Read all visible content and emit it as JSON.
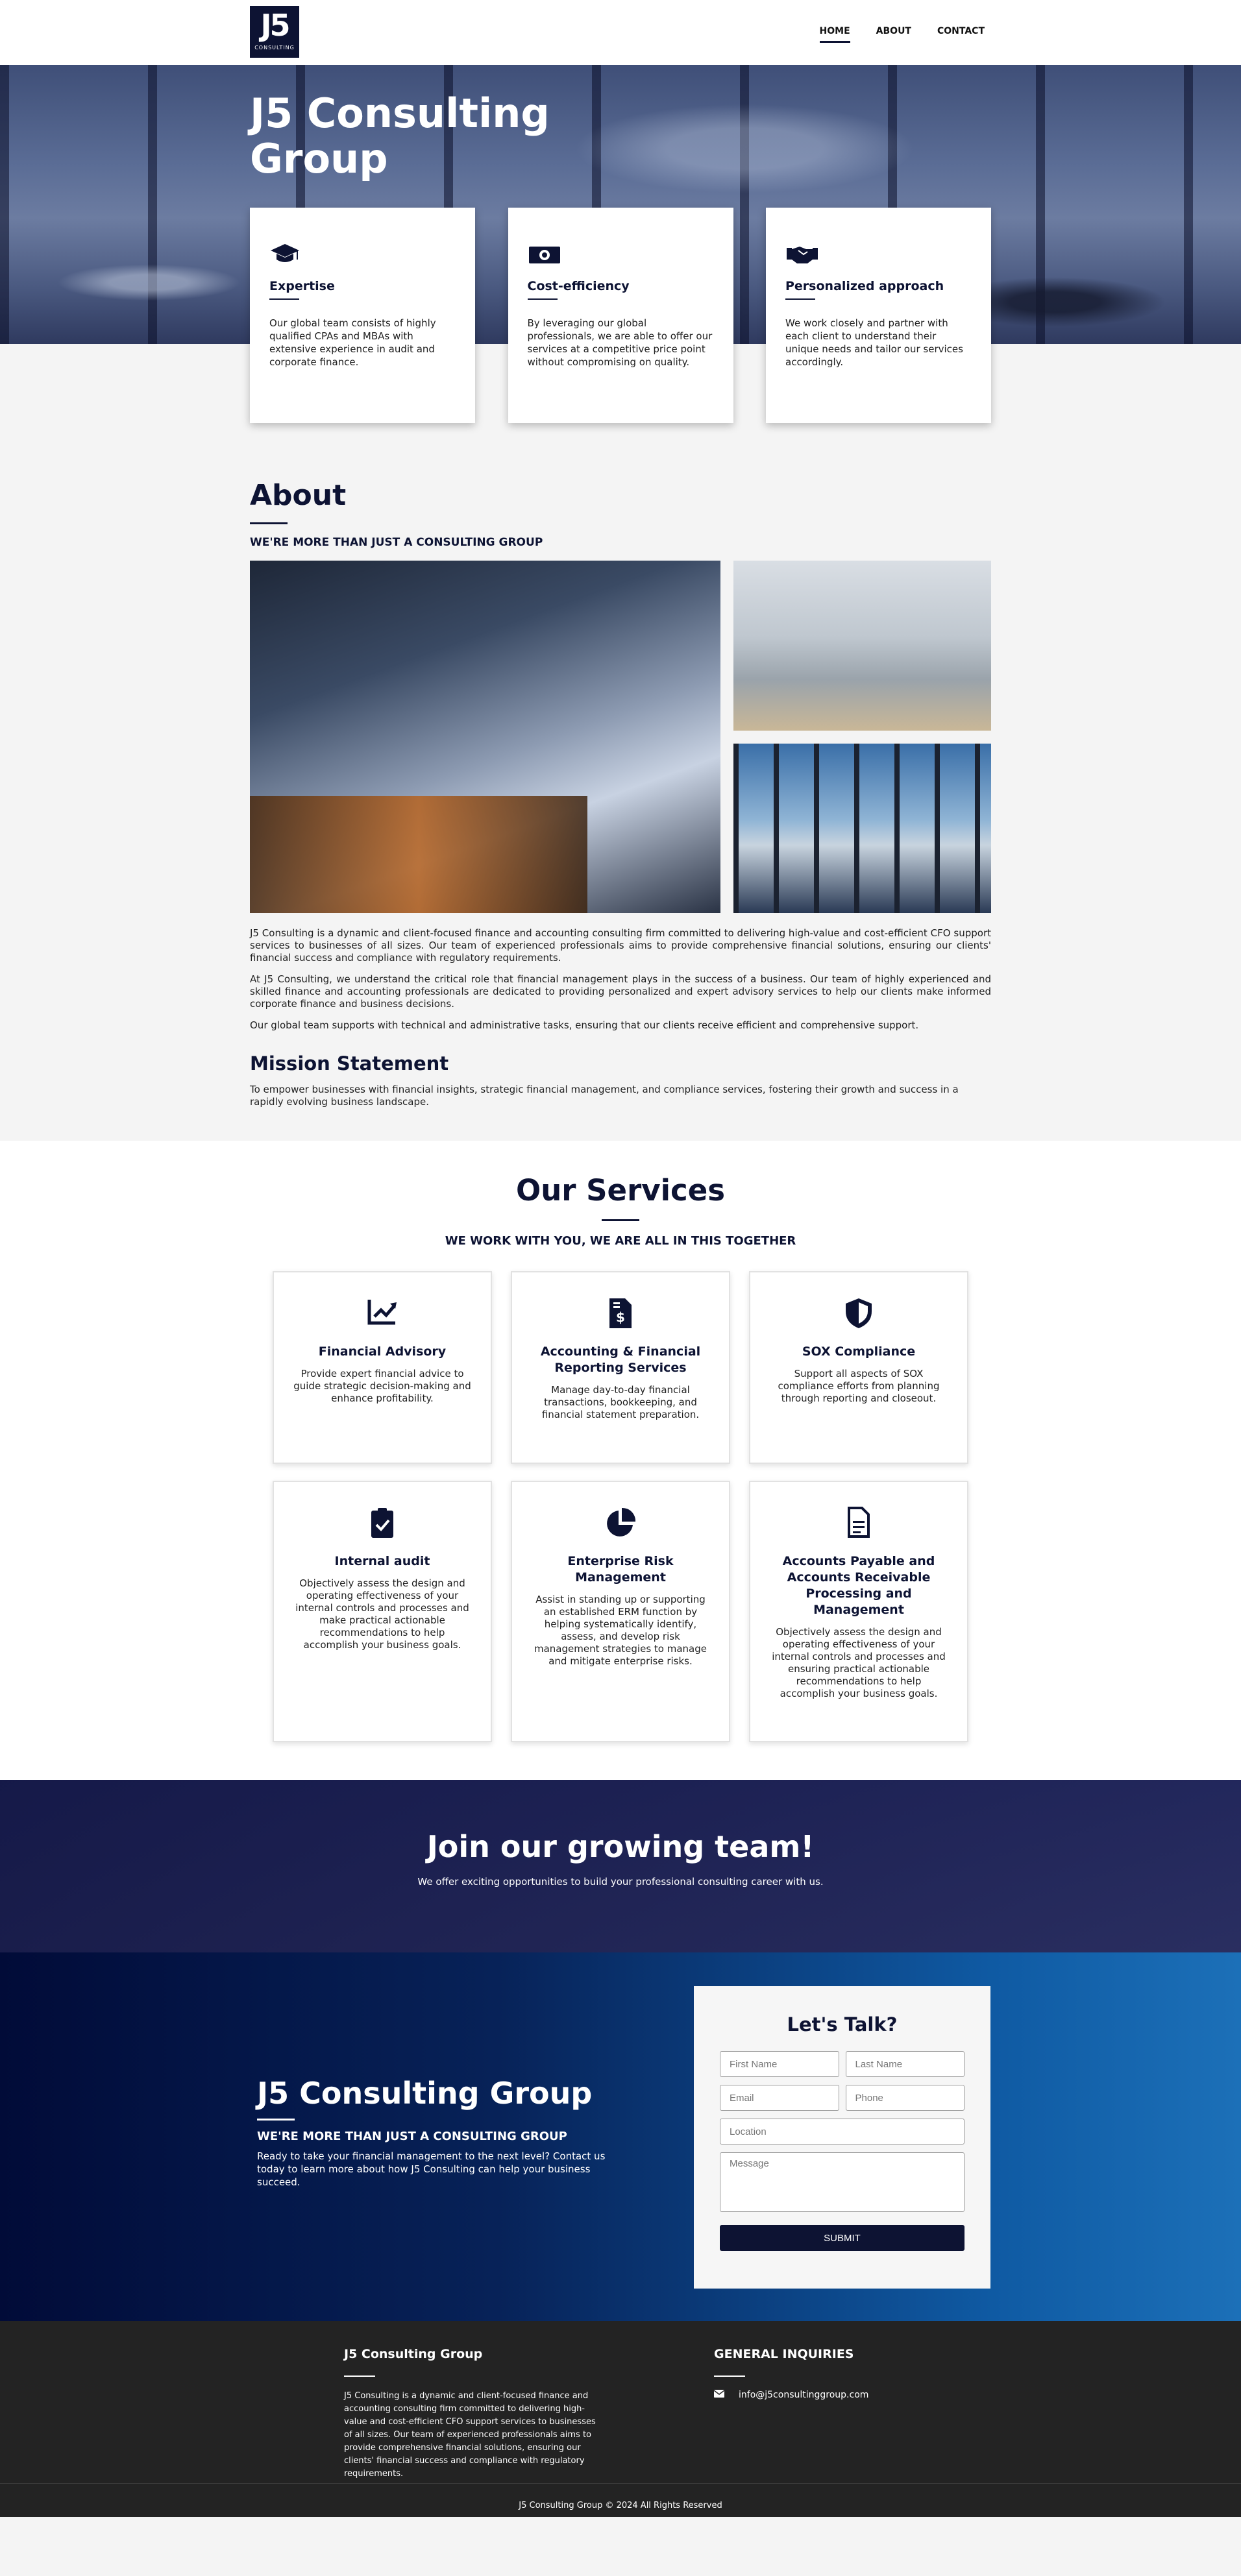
{
  "nav": {
    "logo_big": "J5",
    "logo_small": "CONSULTING",
    "items": [
      "HOME",
      "ABOUT",
      "CONTACT"
    ]
  },
  "hero": {
    "title": "J5 Consulting Group",
    "features": [
      {
        "icon": "graduation-cap-icon",
        "title": "Expertise",
        "text": "Our global team consists of highly qualified CPAs and MBAs with extensive experience in audit and corporate finance."
      },
      {
        "icon": "money-bill-icon",
        "title": "Cost-efficiency",
        "text": "By leveraging our global professionals, we are able to offer our services at a competitive price point without compromising on quality."
      },
      {
        "icon": "handshake-icon",
        "title": "Personalized approach",
        "text": "We work closely and partner with each client to understand their unique needs and tailor our services accordingly."
      }
    ]
  },
  "about": {
    "title": "About",
    "subtitle": "WE'RE MORE THAN JUST A CONSULTING GROUP",
    "paragraphs": [
      "J5 Consulting is a dynamic and client-focused finance and accounting consulting firm committed to delivering high-value and cost-efficient CFO support services to businesses of all sizes. Our team of experienced professionals aims to provide comprehensive financial solutions, ensuring our clients' financial success and compliance with regulatory requirements.",
      "At J5 Consulting, we understand the critical role that financial management plays in the success of a business. Our team of highly experienced and skilled finance and accounting professionals are dedicated to providing personalized and expert advisory services to help our clients make informed corporate finance and business decisions.",
      "Our global team supports with technical and administrative tasks, ensuring that our clients receive efficient and comprehensive support."
    ],
    "mission_title": "Mission Statement",
    "mission_text": "To empower businesses with financial insights, strategic financial management, and compliance services, fostering their growth and success in a rapidly evolving business landscape."
  },
  "services": {
    "title": "Our Services",
    "subtitle": "WE WORK WITH YOU, WE ARE ALL IN THIS TOGETHER",
    "items": [
      {
        "icon": "chart-line-icon",
        "title": "Financial Advisory",
        "text": "Provide expert financial advice to guide strategic decision-making and enhance profitability."
      },
      {
        "icon": "file-invoice-dollar-icon",
        "title": "Accounting & Financial Reporting Services",
        "text": "Manage day-to-day financial transactions, bookkeeping, and financial statement preparation."
      },
      {
        "icon": "shield-icon",
        "title": "SOX Compliance",
        "text": "Support all aspects of SOX compliance efforts from planning through reporting and closeout."
      },
      {
        "icon": "clipboard-check-icon",
        "title": "Internal audit",
        "text": "Objectively assess the design and operating effectiveness of your internal controls and processes and make practical actionable recommendations to help accomplish your business goals."
      },
      {
        "icon": "pie-chart-icon",
        "title": "Enterprise Risk Management",
        "text": "Assist in standing up or supporting an established ERM function by helping systematically identify, assess, and develop risk management strategies to manage and mitigate enterprise risks."
      },
      {
        "icon": "file-text-icon",
        "title": "Accounts Payable and Accounts Receivable Processing and Management",
        "text": "Objectively assess the design and operating effectiveness of your internal controls and processes and ensuring practical actionable recommendations to help accomplish your business goals."
      }
    ]
  },
  "join": {
    "title": "Join our growing team!",
    "text": "We offer exciting opportunities to build your professional consulting career with us."
  },
  "contact": {
    "title": "J5 Consulting Group",
    "subtitle": "WE'RE MORE THAN JUST A CONSULTING GROUP",
    "text": "Ready to take your financial management to the next level? Contact us today to learn more about how J5 Consulting can help your business succeed.",
    "form": {
      "title": "Let's Talk?",
      "first_name": "First Name",
      "last_name": "Last Name",
      "email": "Email",
      "phone": "Phone",
      "location": "Location",
      "message": "Message",
      "submit": "SUBMIT"
    }
  },
  "footer": {
    "col1_title": "J5 Consulting Group",
    "col1_text": "J5 Consulting is a dynamic and client-focused finance and accounting consulting firm committed to delivering high-value and cost-efficient CFO support services to businesses of all sizes. Our team of experienced professionals aims to provide comprehensive financial solutions, ensuring our clients' financial success and compliance with regulatory requirements.",
    "col2_title": "GENERAL INQUIRIES",
    "email": "info@j5consultinggroup.com",
    "copyright": "J5 Consulting Group © 2024 All Rights Reserved"
  }
}
